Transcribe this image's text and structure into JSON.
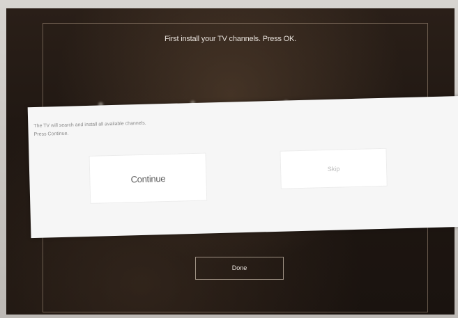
{
  "screen": {
    "prompt_text": "First install your TV channels. Press OK."
  },
  "dialog": {
    "message_line_1": "The TV will search and install all available channels.",
    "message_line_2": "Press Continue.",
    "continue_label": "Continue",
    "skip_label": "Skip"
  },
  "footer": {
    "done_label": "Done"
  },
  "colors": {
    "screen_background": "#1f1712",
    "dialog_background": "#f6f6f6",
    "button_text": "#5b5b5b"
  }
}
